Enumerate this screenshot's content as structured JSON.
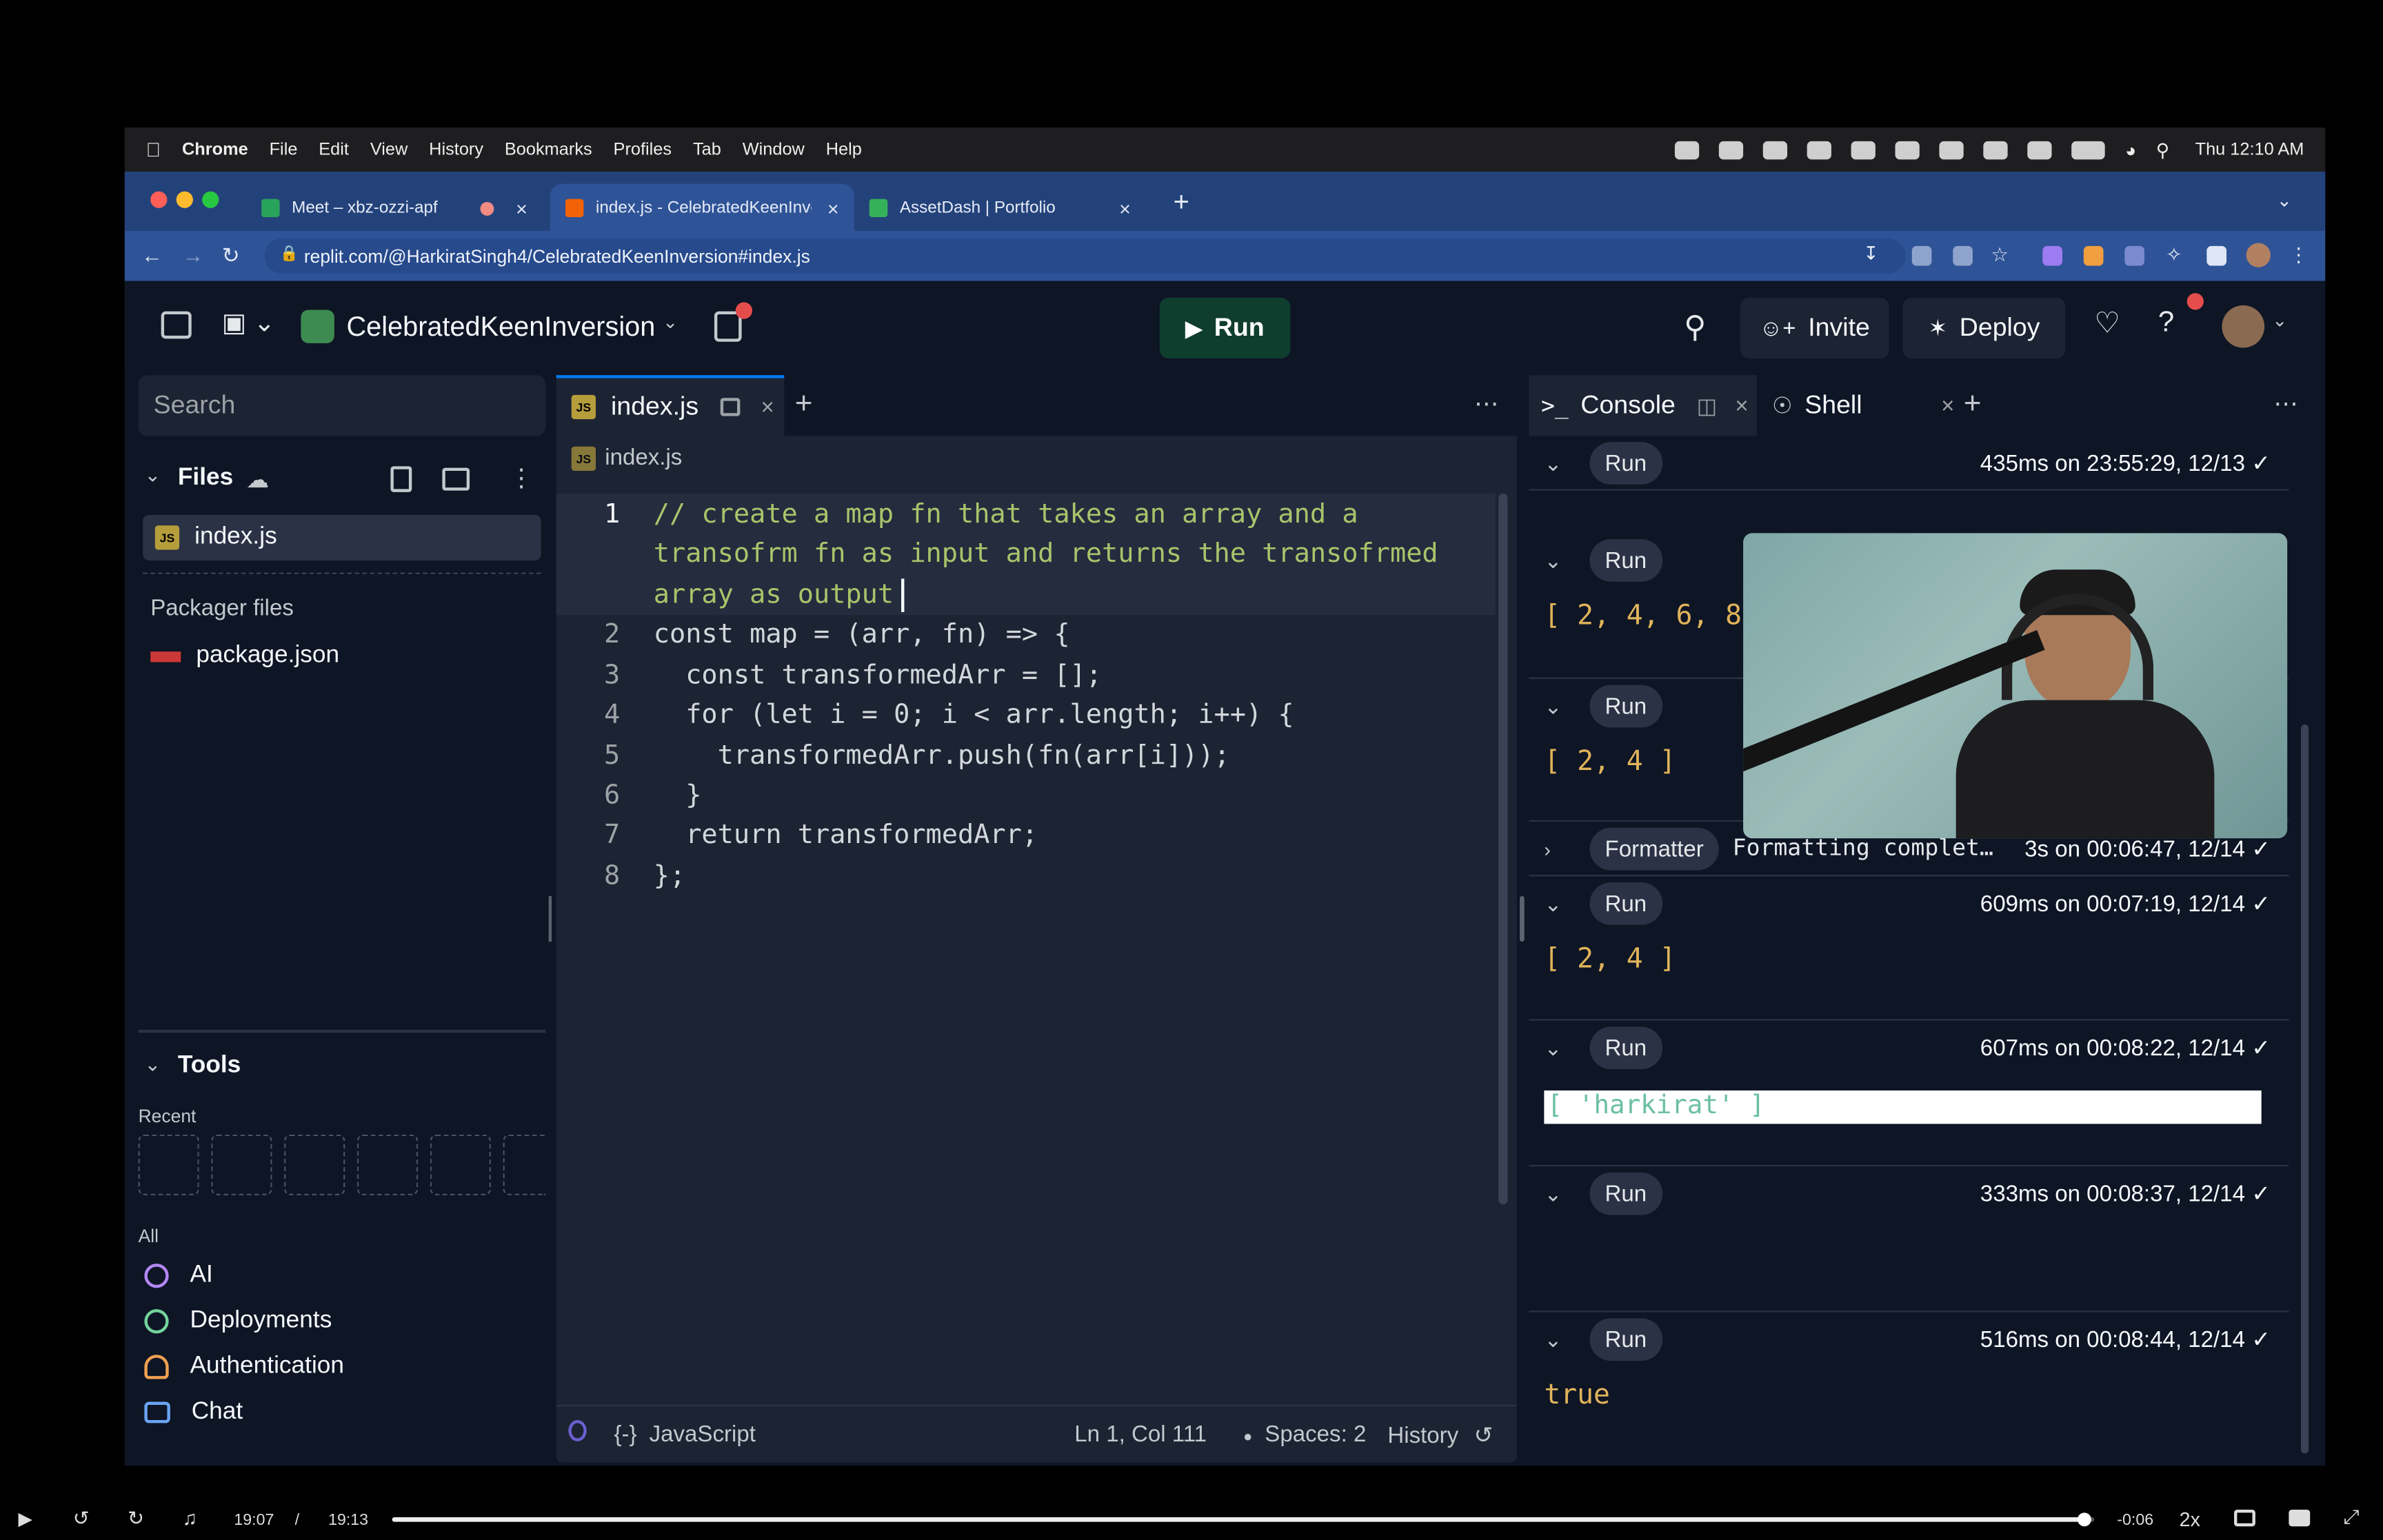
{
  "menubar": {
    "app": "Chrome",
    "items": [
      "File",
      "Edit",
      "View",
      "History",
      "Bookmarks",
      "Profiles",
      "Tab",
      "Window",
      "Help"
    ],
    "clock": "Thu 12:10 AM"
  },
  "browser": {
    "tabs": [
      {
        "title": "Meet – xbz-ozzi-apf",
        "fav_color": "#27a35a"
      },
      {
        "title": "index.js - CelebratedKeenInve",
        "fav_color": "#f26207"
      },
      {
        "title": "AssetDash | Portfolio",
        "fav_color": "#35b15a"
      }
    ],
    "url": "replit.com/@HarkiratSingh4/CelebratedKeenInversion#index.js"
  },
  "replit": {
    "repl_name": "CelebratedKeenInversion",
    "run_label": "Run",
    "invite_label": "Invite",
    "deploy_label": "Deploy",
    "search_placeholder": "Search",
    "files_label": "Files",
    "file_active": "index.js",
    "packager_label": "Packager files",
    "package_file": "package.json",
    "tools_label": "Tools",
    "recent_label": "Recent",
    "all_label": "All",
    "tools": [
      "AI",
      "Deployments",
      "Authentication",
      "Chat"
    ]
  },
  "editor": {
    "tab_label": "index.js",
    "breadcrumb": "index.js",
    "lines": [
      {
        "n": "1",
        "text": "// create a map fn that takes an array and a"
      },
      {
        "n": "",
        "text": "transofrm fn as input and returns the transofrmed"
      },
      {
        "n": "",
        "text": "array as output"
      },
      {
        "n": "2",
        "text": "const map = (arr, fn) => {"
      },
      {
        "n": "3",
        "text": "  const transformedArr = [];"
      },
      {
        "n": "4",
        "text": "  for (let i = 0; i < arr.length; i++) {"
      },
      {
        "n": "5",
        "text": "    transformedArr.push(fn(arr[i]));"
      },
      {
        "n": "6",
        "text": "  }"
      },
      {
        "n": "7",
        "text": "  return transformedArr;"
      },
      {
        "n": "8",
        "text": "};"
      }
    ],
    "language": "JavaScript",
    "cursor": "Ln 1, Col 111",
    "spaces": "Spaces: 2",
    "history": "History"
  },
  "console": {
    "console_tab": "Console",
    "shell_tab": "Shell",
    "entries": [
      {
        "label": "Run",
        "meta": "435ms on 23:55:29, 12/13",
        "output": ""
      },
      {
        "label": "Run",
        "meta": "",
        "output": "[ 2, 4, 6, 8,"
      },
      {
        "label": "Run",
        "meta": "",
        "output": "[ 2, 4 ]"
      },
      {
        "label": "Formatter",
        "meta": "3s on 00:06:47, 12/14",
        "output": "Formatting complet…"
      },
      {
        "label": "Run",
        "meta": "609ms on 00:07:19, 12/14",
        "output": "[ 2, 4 ]"
      },
      {
        "label": "Run",
        "meta": "607ms on 00:08:22, 12/14",
        "output": "[ 'harkirat' ]"
      },
      {
        "label": "Run",
        "meta": "333ms on 00:08:37, 12/14",
        "output": ""
      },
      {
        "label": "Run",
        "meta": "516ms on 00:08:44, 12/14",
        "output": "true"
      }
    ]
  },
  "video": {
    "elapsed": "19:07",
    "separator": "/",
    "total": "19:13",
    "remaining": "-0:06",
    "speed": "2x",
    "progress": 0.995
  }
}
